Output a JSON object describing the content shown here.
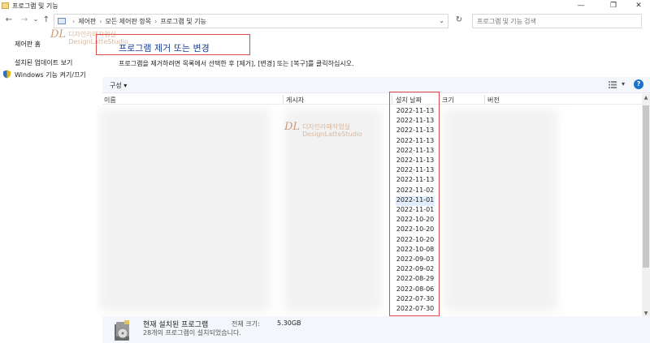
{
  "window": {
    "title": "프로그램 및 기능",
    "minimize": "—",
    "maximize": "❐",
    "close": "✕"
  },
  "nav": {
    "back": "←",
    "forward": "→",
    "recent": "⌄",
    "up": "↑",
    "breadcrumbs": [
      "제어판",
      "모든 제어판 항목",
      "프로그램 및 기능"
    ],
    "separator": "›",
    "dropdown": "⌄",
    "refresh": "↻",
    "search_placeholder": "프로그램 및 기능 검색"
  },
  "sidebar": {
    "home": "제어판 홈",
    "updates": "설치된 업데이트 보기",
    "windows_features": "Windows 기능 켜기/끄기"
  },
  "watermark": {
    "logo": "DL",
    "line1": "디자인라떼작업실",
    "line2": "DesignLatteStudio"
  },
  "main": {
    "heading": "프로그램 제거 또는 변경",
    "instructions": "프로그램을 제거하려면 목록에서 선택한 후 [제거], [변경] 또는 [복구]를 클릭하십시오."
  },
  "toolbar": {
    "organize": "구성 ▾",
    "view_dropdown": "▾",
    "help": "?"
  },
  "columns": {
    "name": "이름",
    "publisher": "게시자",
    "install_date": "설치 날짜",
    "size": "크기",
    "version": "버전"
  },
  "install_dates": [
    "2022-11-13",
    "2022-11-13",
    "2022-11-13",
    "2022-11-13",
    "2022-11-13",
    "2022-11-13",
    "2022-11-13",
    "2022-11-13",
    "2022-11-02",
    "2022-11-01",
    "2022-11-01",
    "2022-10-20",
    "2022-10-20",
    "2022-10-20",
    "2022-10-08",
    "2022-09-03",
    "2022-09-02",
    "2022-08-29",
    "2022-08-06",
    "2022-07-30",
    "2022-07-30"
  ],
  "selected_row": 9,
  "details": {
    "title": "현재 설치된 프로그램",
    "total_size_label": "전체 크기:",
    "total_size_value": "5.30GB",
    "count_text": "28개의 프로그램이 설치되었습니다."
  },
  "colors": {
    "highlight_border": "#e34b4b",
    "heading": "#1c3f94",
    "selection": "#e1edfb"
  }
}
